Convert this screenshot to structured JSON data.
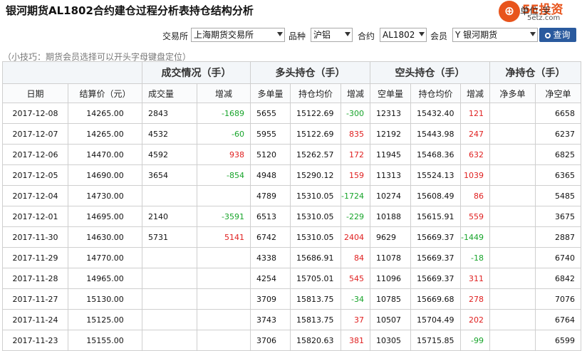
{
  "title": "银河期货AL1802合约建仓过程分析表持仓结构分析",
  "logo": {
    "brand": "5E投资",
    "domain": "5etz.com",
    "overlay": "单位:手"
  },
  "filters": {
    "exchange_label": "交易所",
    "exchange_value": "上海期货交易所",
    "variety_label": "品种",
    "variety_value": "沪铝",
    "contract_label": "合约",
    "contract_value": "AL1802",
    "member_label": "会员",
    "member_value": "Y 银河期货",
    "query_label": "查询"
  },
  "tip": "（小技巧：期货会员选择可以开头字母键盘定位）",
  "groups": [
    "成交情况（手）",
    "多头持仓（手）",
    "空头持仓（手）",
    "净持仓（手）"
  ],
  "columns": [
    "日期",
    "结算价（元）",
    "成交量",
    "增减",
    "多单量",
    "持仓均价",
    "增减",
    "空单量",
    "持仓均价",
    "增减",
    "净多单",
    "净空单"
  ],
  "rows": [
    {
      "date": "2017-12-08",
      "price": "14265.00",
      "vol": "2843",
      "vol_chg": "-1689",
      "long": "5655",
      "long_avg": "15122.69",
      "long_chg": "-300",
      "short": "12313",
      "short_avg": "15432.40",
      "short_chg": "121",
      "net_long": "",
      "net_short": "6658"
    },
    {
      "date": "2017-12-07",
      "price": "14265.00",
      "vol": "4532",
      "vol_chg": "-60",
      "long": "5955",
      "long_avg": "15122.69",
      "long_chg": "835",
      "short": "12192",
      "short_avg": "15443.98",
      "short_chg": "247",
      "net_long": "",
      "net_short": "6237"
    },
    {
      "date": "2017-12-06",
      "price": "14470.00",
      "vol": "4592",
      "vol_chg": "938",
      "long": "5120",
      "long_avg": "15262.57",
      "long_chg": "172",
      "short": "11945",
      "short_avg": "15468.36",
      "short_chg": "632",
      "net_long": "",
      "net_short": "6825"
    },
    {
      "date": "2017-12-05",
      "price": "14690.00",
      "vol": "3654",
      "vol_chg": "-854",
      "long": "4948",
      "long_avg": "15290.12",
      "long_chg": "159",
      "short": "11313",
      "short_avg": "15524.13",
      "short_chg": "1039",
      "net_long": "",
      "net_short": "6365"
    },
    {
      "date": "2017-12-04",
      "price": "14730.00",
      "vol": "",
      "vol_chg": "",
      "long": "4789",
      "long_avg": "15310.05",
      "long_chg": "-1724",
      "short": "10274",
      "short_avg": "15608.49",
      "short_chg": "86",
      "net_long": "",
      "net_short": "5485"
    },
    {
      "date": "2017-12-01",
      "price": "14695.00",
      "vol": "2140",
      "vol_chg": "-3591",
      "long": "6513",
      "long_avg": "15310.05",
      "long_chg": "-229",
      "short": "10188",
      "short_avg": "15615.91",
      "short_chg": "559",
      "net_long": "",
      "net_short": "3675"
    },
    {
      "date": "2017-11-30",
      "price": "14630.00",
      "vol": "5731",
      "vol_chg": "5141",
      "long": "6742",
      "long_avg": "15310.05",
      "long_chg": "2404",
      "short": "9629",
      "short_avg": "15669.37",
      "short_chg": "-1449",
      "net_long": "",
      "net_short": "2887"
    },
    {
      "date": "2017-11-29",
      "price": "14770.00",
      "vol": "",
      "vol_chg": "",
      "long": "4338",
      "long_avg": "15686.91",
      "long_chg": "84",
      "short": "11078",
      "short_avg": "15669.37",
      "short_chg": "-18",
      "net_long": "",
      "net_short": "6740"
    },
    {
      "date": "2017-11-28",
      "price": "14965.00",
      "vol": "",
      "vol_chg": "",
      "long": "4254",
      "long_avg": "15705.01",
      "long_chg": "545",
      "short": "11096",
      "short_avg": "15669.37",
      "short_chg": "311",
      "net_long": "",
      "net_short": "6842"
    },
    {
      "date": "2017-11-27",
      "price": "15130.00",
      "vol": "",
      "vol_chg": "",
      "long": "3709",
      "long_avg": "15813.75",
      "long_chg": "-34",
      "short": "10785",
      "short_avg": "15669.68",
      "short_chg": "278",
      "net_long": "",
      "net_short": "7076"
    },
    {
      "date": "2017-11-24",
      "price": "15125.00",
      "vol": "",
      "vol_chg": "",
      "long": "3743",
      "long_avg": "15813.75",
      "long_chg": "37",
      "short": "10507",
      "short_avg": "15704.49",
      "short_chg": "202",
      "net_long": "",
      "net_short": "6764"
    },
    {
      "date": "2017-11-23",
      "price": "15155.00",
      "vol": "",
      "vol_chg": "",
      "long": "3706",
      "long_avg": "15820.63",
      "long_chg": "381",
      "short": "10305",
      "short_avg": "15715.85",
      "short_chg": "-99",
      "net_long": "",
      "net_short": "6599"
    }
  ],
  "colors": {
    "positive": "#e02020",
    "negative": "#17a42a",
    "accent": "#2a5a9e",
    "logo": "#e8541c"
  }
}
